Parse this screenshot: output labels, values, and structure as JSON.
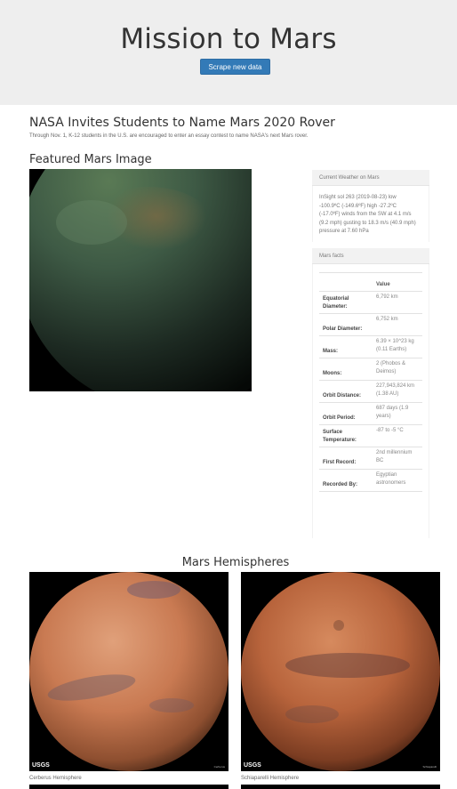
{
  "header": {
    "title": "Mission to Mars",
    "scrape_button": "Scrape new data"
  },
  "news": {
    "title": "NASA Invites Students to Name Mars 2020 Rover",
    "paragraph": "Through Nov. 1, K-12 students in the U.S. are encouraged to enter an essay contest to name NASA's next Mars rover."
  },
  "featured": {
    "title": "Featured Mars Image"
  },
  "weather": {
    "heading": "Current Weather on Mars",
    "text": "InSight sol 263 (2019-08-23) low -100.9ºC (-149.6ºF) high -27.2ºC (-17.0ºF) winds from the SW at 4.1 m/s (9.2 mph) gusting to 18.3 m/s (40.9 mph) pressure at 7.60 hPa"
  },
  "facts": {
    "heading": "Mars facts",
    "value_header": "Value",
    "rows": [
      {
        "label": "Equatorial Diameter:",
        "value": "6,792 km"
      },
      {
        "label": "Polar Diameter:",
        "value": "6,752 km"
      },
      {
        "label": "Mass:",
        "value": "6.39 × 10^23 kg (0.11 Earths)"
      },
      {
        "label": "Moons:",
        "value": "2 (Phobos & Deimos)"
      },
      {
        "label": "Orbit Distance:",
        "value": "227,943,824 km (1.38 AU)"
      },
      {
        "label": "Orbit Period:",
        "value": "687 days (1.9 years)"
      },
      {
        "label": "Surface Temperature:",
        "value": "-87 to -5 °C"
      },
      {
        "label": "First Record:",
        "value": "2nd millennium BC"
      },
      {
        "label": "Recorded By:",
        "value": "Egyptian astronomers"
      }
    ]
  },
  "hemispheres": {
    "title": "Mars Hemispheres",
    "items": [
      {
        "caption": "Cerberus Hemisphere",
        "logo": "USGS",
        "image_label": "Cerberus"
      },
      {
        "caption": "Schiaparelli Hemisphere",
        "logo": "USGS",
        "image_label": "Schiaparelli"
      }
    ]
  },
  "colors": {
    "jumbotron_bg": "#eeeeee",
    "button_bg": "#337ab7",
    "mars_orange": "#c8784d"
  }
}
